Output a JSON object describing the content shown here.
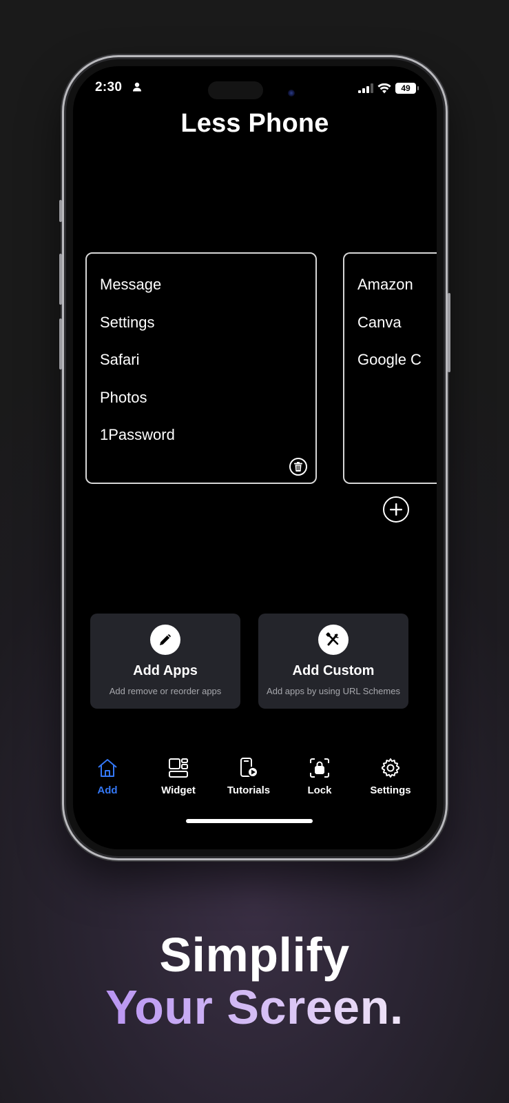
{
  "status_bar": {
    "time": "2:30",
    "battery": "49"
  },
  "app_title": "Less Phone",
  "pages": [
    {
      "apps": [
        "Message",
        "Settings",
        "Safari",
        "Photos",
        "1Password"
      ]
    },
    {
      "apps": [
        "Amazon",
        "Canva",
        "Google C"
      ]
    }
  ],
  "actions": [
    {
      "title": "Add Apps",
      "subtitle": "Add remove or reorder apps",
      "icon": "pencil-icon"
    },
    {
      "title": "Add Custom",
      "subtitle": "Add apps by using URL Schemes",
      "icon": "tools-icon"
    }
  ],
  "tabs": [
    {
      "label": "Add",
      "icon": "house-icon",
      "active": true
    },
    {
      "label": "Widget",
      "icon": "widget-icon",
      "active": false
    },
    {
      "label": "Tutorials",
      "icon": "tutorial-icon",
      "active": false
    },
    {
      "label": "Lock",
      "icon": "lock-icon",
      "active": false
    },
    {
      "label": "Settings",
      "icon": "gear-icon",
      "active": false
    }
  ],
  "colors": {
    "accent": "#3478F6",
    "headline_gradient_start": "#B995F2",
    "headline_gradient_end": "#EFE4F7"
  },
  "headline": {
    "line1": "Simplify",
    "line2": "Your Screen."
  }
}
